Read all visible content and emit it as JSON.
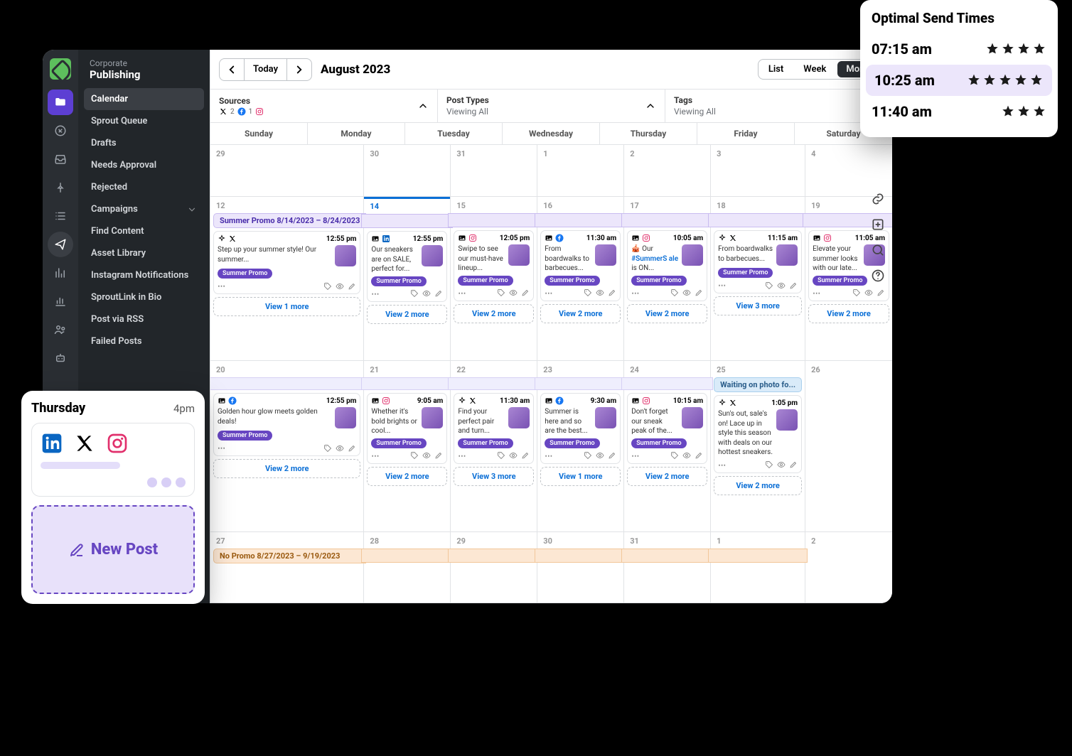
{
  "app": {
    "corporate": "Corporate",
    "section": "Publishing"
  },
  "sidebar": {
    "items": [
      "Calendar",
      "Sprout Queue",
      "Drafts",
      "Needs Approval",
      "Rejected",
      "Campaigns",
      "Find Content",
      "Asset Library",
      "Instagram Notifications",
      "SproutLink in Bio",
      "Post via RSS",
      "Failed Posts"
    ]
  },
  "toolbar": {
    "today": "Today",
    "title": "August 2023",
    "views": {
      "list": "List",
      "week": "Week",
      "month": "Month"
    }
  },
  "filters": {
    "sources": {
      "title": "Sources",
      "x_count": "2",
      "fb_count": "1"
    },
    "posttypes": {
      "title": "Post Types",
      "sub": "Viewing All"
    },
    "tags": {
      "title": "Tags",
      "sub": "Viewing All"
    }
  },
  "days_of_week": [
    "Sunday",
    "Monday",
    "Tuesday",
    "Wednesday",
    "Thursday",
    "Friday",
    "Saturday"
  ],
  "row1": [
    "29",
    "30",
    "31",
    "1",
    "2",
    "3",
    "4"
  ],
  "row2": [
    "12",
    "14",
    "15",
    "16",
    "17",
    "18",
    "19"
  ],
  "row3": [
    "20",
    "21",
    "22",
    "23",
    "24",
    "25",
    "26"
  ],
  "row4": [
    "27",
    "28",
    "29",
    "30",
    "31",
    "1",
    "2"
  ],
  "campaign": {
    "summer": "Summer Promo  8/14/2023 – 8/24/2023",
    "waiting": "Waiting on photo fo...",
    "nopromo": "No Promo 8/27/2023 – 9/19/2023"
  },
  "tag_label": "Summer Promo",
  "week2": [
    {
      "net": "x",
      "time": "12:55 pm",
      "text": "Step up your summer style! Our summer...",
      "more": "View 1 more"
    },
    {
      "net": "li",
      "time": "12:55 pm",
      "text": "Our sneakers are on SALE, perfect for...",
      "more": "View 2 more"
    },
    {
      "net": "ig",
      "time": "12:05 pm",
      "text": "Swipe to see our must-have lineup...",
      "more": "View 2 more"
    },
    {
      "net": "fb",
      "time": "11:30 am",
      "text": "From boardwalks to barbecues...",
      "more": "View 2 more"
    },
    {
      "net": "ig",
      "time": "10:05 am",
      "text": "🎪 Our #SummerSale is ON...",
      "hash": true,
      "more": "View 2 more"
    },
    {
      "net": "x",
      "time": "11:15 am",
      "text": "From boardwalks to barbecues...",
      "more": "View 3 more"
    },
    {
      "net": "ig",
      "time": "11:05 am",
      "text": "Elevate your summer looks with our late...",
      "more": "View 2 more"
    }
  ],
  "week3": [
    {
      "net": "fb",
      "time": "12:55 pm",
      "text": "Golden hour glow meets golden deals!",
      "more": "View 2 more"
    },
    {
      "net": "ig",
      "time": "9:05 am",
      "text": "Whether it's bold brights or cool...",
      "more": "View 2 more"
    },
    {
      "net": "x",
      "time": "11:30 am",
      "text": "Find your perfect pair and turn...",
      "more": "View 3 more"
    },
    {
      "net": "fb",
      "time": "9:30 am",
      "text": "Summer is here and so are the best...",
      "more": "View 1 more"
    },
    {
      "net": "ig",
      "time": "10:15 am",
      "text": "Don't forget our sneak peak of the...",
      "more": "View 2 more"
    },
    {
      "net": "x",
      "time": "1:05 pm",
      "text": "Sun's out, sale's on! Lace up in style this season with deals on our hottest sneakers.",
      "notag": true,
      "more": "View 2 more"
    }
  ],
  "preview": {
    "day": "Thursday",
    "time": "4pm",
    "new": "New Post"
  },
  "sendtimes": {
    "title": "Optimal Send Times",
    "rows": [
      {
        "time": "07:15 am",
        "stars": 4
      },
      {
        "time": "10:25 am",
        "stars": 5,
        "hl": true
      },
      {
        "time": "11:40 am",
        "stars": 3
      }
    ]
  }
}
